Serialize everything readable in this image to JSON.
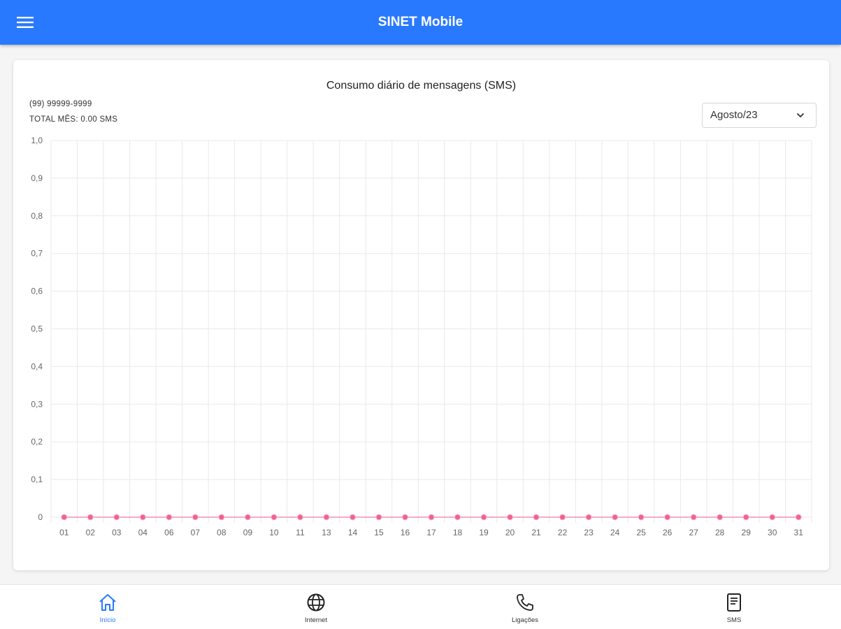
{
  "app": {
    "title": "SINET Mobile"
  },
  "header": {
    "menu_icon": "menu-icon"
  },
  "card": {
    "chart_title": "Consumo diário de mensagens (SMS)",
    "phone": "(99) 99999-9999",
    "total_label": "TOTAL MÊS: 0.00 SMS",
    "month_select": {
      "value": "Agosto/23",
      "icon": "chevron-down-icon"
    }
  },
  "chart_data": {
    "type": "line",
    "title": "Consumo diário de mensagens (SMS)",
    "xlabel": "",
    "ylabel": "",
    "x": [
      "01",
      "02",
      "03",
      "04",
      "06",
      "07",
      "08",
      "09",
      "10",
      "11",
      "13",
      "14",
      "15",
      "16",
      "17",
      "18",
      "19",
      "20",
      "21",
      "22",
      "23",
      "24",
      "25",
      "26",
      "27",
      "28",
      "29",
      "30",
      "31"
    ],
    "series": [
      {
        "values": [
          0,
          0,
          0,
          0,
          0,
          0,
          0,
          0,
          0,
          0,
          0,
          0,
          0,
          0,
          0,
          0,
          0,
          0,
          0,
          0,
          0,
          0,
          0,
          0,
          0,
          0,
          0,
          0,
          0
        ]
      }
    ],
    "ylim": [
      0,
      1.0
    ],
    "yticks": [
      "0",
      "0,1",
      "0,2",
      "0,3",
      "0,4",
      "0,5",
      "0,6",
      "0,7",
      "0,8",
      "0,9",
      "1,0"
    ],
    "grid": true,
    "line_color": "#f48fb1",
    "point_color": "#f06292"
  },
  "bottom_nav": {
    "items": [
      {
        "label": "Início",
        "icon": "home-icon",
        "active": true
      },
      {
        "label": "Internet",
        "icon": "globe-icon",
        "active": false
      },
      {
        "label": "Ligações",
        "icon": "phone-icon",
        "active": false
      },
      {
        "label": "SMS",
        "icon": "sms-icon",
        "active": false
      }
    ]
  },
  "colors": {
    "primary": "#2979ff",
    "background": "#f5f5f5",
    "card": "#ffffff"
  }
}
